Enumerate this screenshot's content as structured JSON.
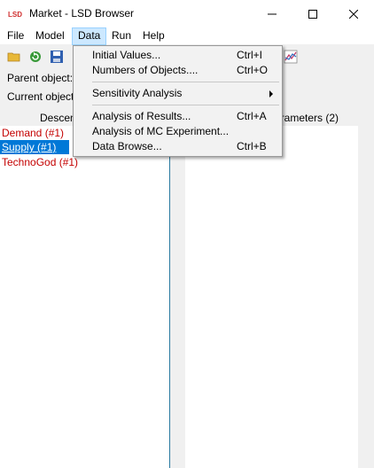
{
  "window": {
    "title": "Market - LSD Browser",
    "app_icon_text": "LSD"
  },
  "menubar": {
    "items": [
      "File",
      "Model",
      "Data",
      "Run",
      "Help"
    ],
    "active": "Data"
  },
  "info": {
    "parent_label": "Parent object:",
    "current_label": "Current object"
  },
  "panels": {
    "left_header": "Descen",
    "right_header": "arameters (2)"
  },
  "objects": [
    {
      "label": "Demand (#1)",
      "selected": false
    },
    {
      "label": "Supply (#1)",
      "selected": true
    },
    {
      "label": "TechnoGod (#1)",
      "selected": false
    }
  ],
  "data_menu": {
    "initial_values": {
      "label": "Initial Values...",
      "shortcut": "Ctrl+I"
    },
    "numbers_of_objects": {
      "label": "Numbers of Objects....",
      "shortcut": "Ctrl+O"
    },
    "sensitivity_analysis": {
      "label": "Sensitivity Analysis"
    },
    "analysis_of_results": {
      "label": "Analysis of Results...",
      "shortcut": "Ctrl+A"
    },
    "analysis_mc": {
      "label": "Analysis of MC Experiment..."
    },
    "data_browse": {
      "label": "Data Browse...",
      "shortcut": "Ctrl+B"
    }
  },
  "colors": {
    "selection": "#0078d7",
    "object_text": "#c40000",
    "menu_highlight": "#cce8ff"
  },
  "icons": [
    "open-folder-icon",
    "reload-icon",
    "save-icon",
    "chart-icon"
  ]
}
